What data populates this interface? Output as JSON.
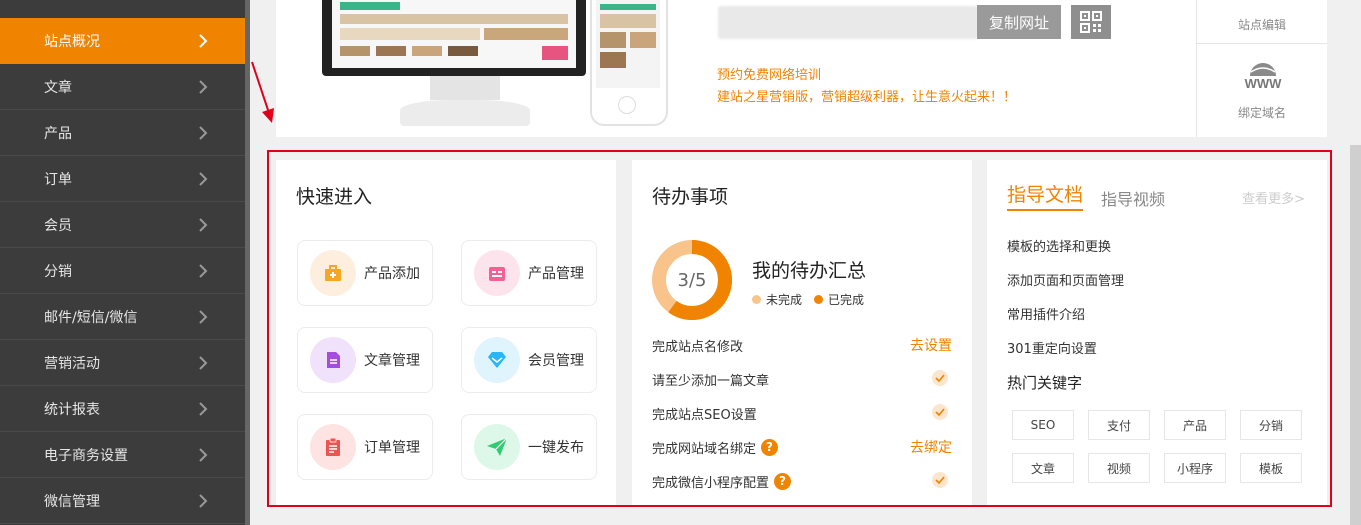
{
  "sidebar": {
    "items": [
      {
        "label": "站点概况",
        "active": true
      },
      {
        "label": "文章"
      },
      {
        "label": "产品"
      },
      {
        "label": "订单"
      },
      {
        "label": "会员"
      },
      {
        "label": "分销"
      },
      {
        "label": "邮件/短信/微信"
      },
      {
        "label": "营销活动"
      },
      {
        "label": "统计报表"
      },
      {
        "label": "电子商务设置"
      },
      {
        "label": "微信管理"
      }
    ]
  },
  "site": {
    "copy_url_label": "复制网址",
    "qr_icon": "qr-code-icon",
    "promo_line1": "预约免费网络培训",
    "promo_line2": "建站之星营销版，营销超级利器，让生意火起来！！",
    "edit_label": "站点编辑",
    "domain_label": "绑定域名",
    "domain_icon_text": "WWW"
  },
  "quick": {
    "title": "快速进入",
    "tiles": [
      {
        "label": "产品添加",
        "icon": "product-add-icon",
        "color": "#f5a623"
      },
      {
        "label": "产品管理",
        "icon": "product-manage-icon",
        "color": "#f06292"
      },
      {
        "label": "文章管理",
        "icon": "article-icon",
        "color": "#a64de0"
      },
      {
        "label": "会员管理",
        "icon": "member-icon",
        "color": "#29b6f6"
      },
      {
        "label": "订单管理",
        "icon": "order-icon",
        "color": "#ef5350"
      },
      {
        "label": "一键发布",
        "icon": "publish-icon",
        "color": "#2ecc71"
      }
    ]
  },
  "todo": {
    "title": "待办事项",
    "summary_title": "我的待办汇总",
    "progress_text": "3/5",
    "progress_fraction": 0.6,
    "legend_incomplete": "未完成",
    "legend_complete": "已完成",
    "colors": {
      "incomplete": "#f9c48c",
      "complete": "#f08300"
    },
    "items": [
      {
        "text": "完成站点名修改",
        "action": "去设置",
        "done": false,
        "help": false
      },
      {
        "text": "请至少添加一篇文章",
        "action": "",
        "done": true,
        "help": false
      },
      {
        "text": "完成站点SEO设置",
        "action": "",
        "done": true,
        "help": false
      },
      {
        "text": "完成网站域名绑定",
        "action": "去绑定",
        "done": false,
        "help": true
      },
      {
        "text": "完成微信小程序配置",
        "action": "",
        "done": true,
        "help": true
      }
    ]
  },
  "guide": {
    "tab_docs": "指导文档",
    "tab_videos": "指导视频",
    "more": "查看更多>",
    "links": [
      "模板的选择和更换",
      "添加页面和页面管理",
      "常用插件介绍",
      "301重定向设置"
    ],
    "hot_title": "热门关键字",
    "keywords": [
      "SEO",
      "支付",
      "产品",
      "分销",
      "文章",
      "视频",
      "小程序",
      "模板"
    ]
  },
  "accent": "#f08300"
}
